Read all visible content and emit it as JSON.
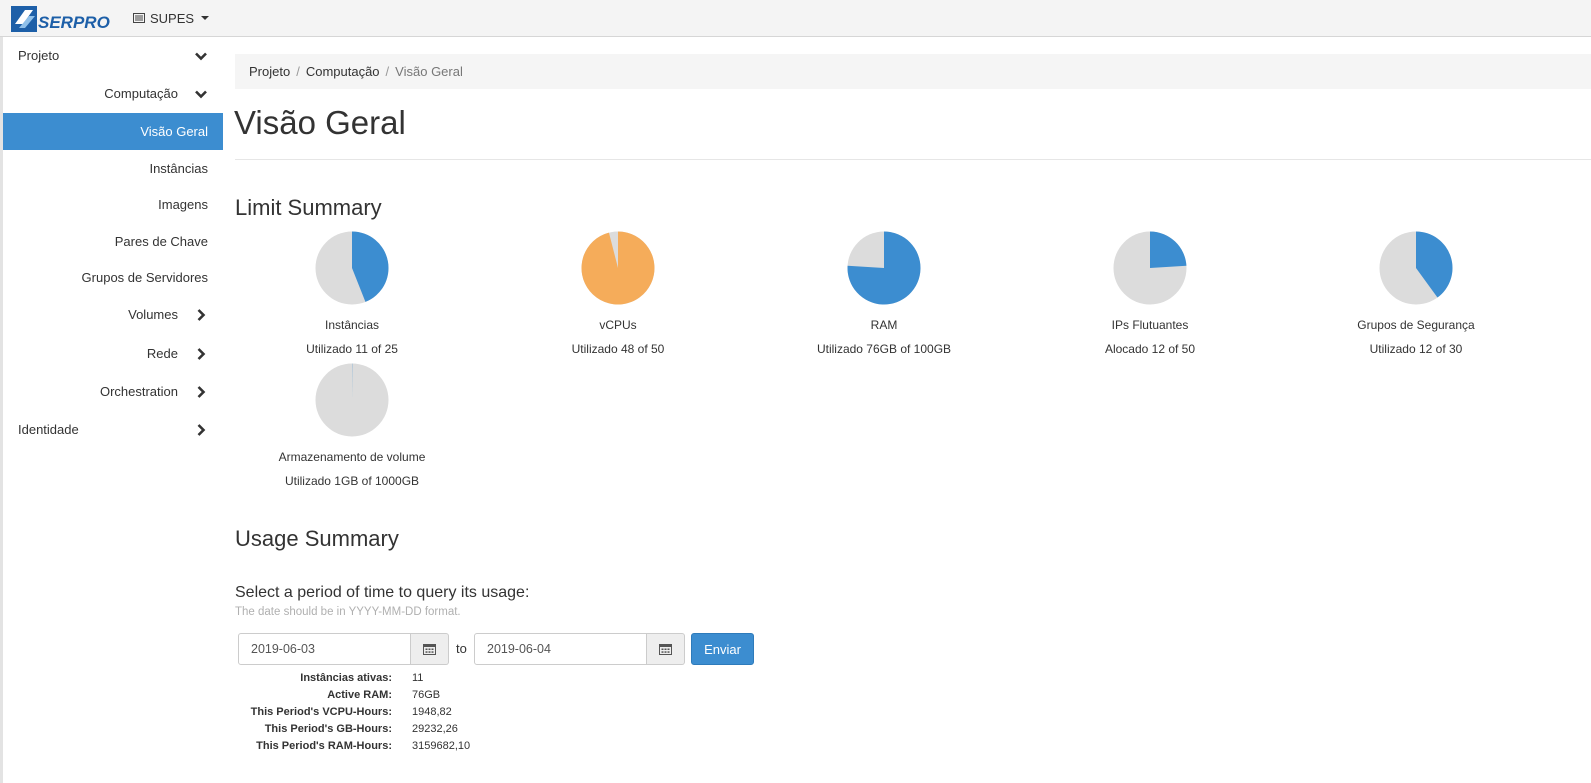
{
  "header": {
    "logo_text": "SERPRO",
    "project_label": "SUPES"
  },
  "sidebar": {
    "projeto": "Projeto",
    "computacao": "Computação",
    "visao_geral": "Visão Geral",
    "instancias": "Instâncias",
    "imagens": "Imagens",
    "pares_chave": "Pares de Chave",
    "grupos_servidores": "Grupos de Servidores",
    "volumes": "Volumes",
    "rede": "Rede",
    "orchestration": "Orchestration",
    "identidade": "Identidade"
  },
  "breadcrumb": {
    "items": [
      "Projeto",
      "Computação"
    ],
    "separator": "/",
    "current": "Visão Geral"
  },
  "page": {
    "title": "Visão Geral",
    "limit_summary_title": "Limit Summary",
    "usage_summary_title": "Usage Summary"
  },
  "colors": {
    "accent": "#3c8dd0",
    "warning": "#f5ac5a",
    "pie_empty": "#dcdcdc"
  },
  "limits": [
    {
      "name": "Instâncias",
      "usage_text": "Utilizado 11 of 25",
      "used": 11,
      "total": 25,
      "color": "#3c8dd0"
    },
    {
      "name": "vCPUs",
      "usage_text": "Utilizado 48 of 50",
      "used": 48,
      "total": 50,
      "color": "#f5ac5a"
    },
    {
      "name": "RAM",
      "usage_text": "Utilizado 76GB of 100GB",
      "used": 76,
      "total": 100,
      "color": "#3c8dd0"
    },
    {
      "name": "IPs Flutuantes",
      "usage_text": "Alocado 12 of 50",
      "used": 12,
      "total": 50,
      "color": "#3c8dd0"
    },
    {
      "name": "Grupos de Segurança",
      "usage_text": "Utilizado 12 of 30",
      "used": 12,
      "total": 30,
      "color": "#3c8dd0"
    },
    {
      "name": "Armazenamento de volume",
      "usage_text": "Utilizado 1GB of 1000GB",
      "used": 1,
      "total": 1000,
      "color": "#3c8dd0"
    }
  ],
  "usage": {
    "query_label": "Select a period of time to query its usage:",
    "hint": "The date should be in YYYY-MM-DD format.",
    "start_date": "2019-06-03",
    "to_label": "to",
    "end_date": "2019-06-04",
    "submit_label": "Enviar",
    "stats": [
      {
        "label": "Instâncias ativas:",
        "value": "11"
      },
      {
        "label": "Active RAM:",
        "value": "76GB"
      },
      {
        "label": "This Period's VCPU-Hours:",
        "value": "1948,82"
      },
      {
        "label": "This Period's GB-Hours:",
        "value": "29232,26"
      },
      {
        "label": "This Period's RAM-Hours:",
        "value": "3159682,10"
      }
    ]
  }
}
